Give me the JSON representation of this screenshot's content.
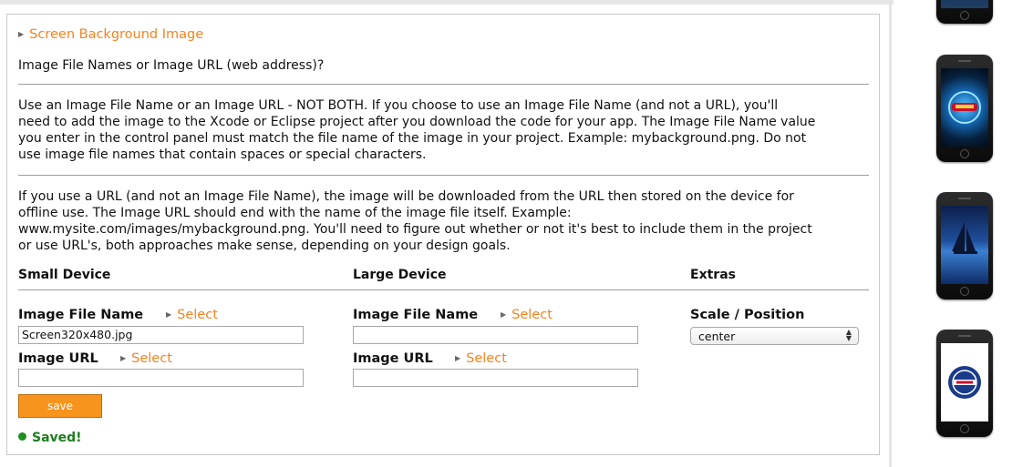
{
  "section": {
    "title": "Screen Background Image"
  },
  "question": "Image File Names or Image URL (web address)?",
  "paragraphs": {
    "p1_l1": "Use an Image File Name or an Image URL - NOT BOTH. If you choose to use an Image File Name (and not a URL), you'll",
    "p1_l2": "need to add the image to the Xcode or Eclipse project after you download the code for your app. The Image File Name value",
    "p1_l3": "you enter in the control panel must match the file name of the image in your project. Example: mybackground.png. Do not",
    "p1_l4": "use image file names that contain spaces or special characters.",
    "p2_l1": "If you use a URL (and not an Image File Name), the image will be downloaded from the URL then stored on the device for",
    "p2_l2": "offline use. The Image URL should end with the name of the image file itself. Example:",
    "p2_l3": "www.mysite.com/images/mybackground.png. You'll need to figure out whether or not it's best to include them in the project",
    "p2_l4": "or use URL's, both approaches make sense, depending on your design goals."
  },
  "columns": {
    "small": "Small Device",
    "large": "Large Device",
    "extras": "Extras"
  },
  "fields": {
    "image_file_name_label": "Image File Name",
    "image_url_label": "Image URL",
    "select_label": "Select",
    "small_file_value": "Screen320x480.jpg",
    "small_url_value": "",
    "large_file_value": "",
    "large_url_value": "",
    "scale_label": "Scale / Position",
    "scale_value": "center"
  },
  "actions": {
    "save_label": "save"
  },
  "status": {
    "saved_text": "Saved!",
    "color": "#1d7e1d"
  },
  "accent_color": "#f5821f",
  "thumbnails": [
    {
      "name": "phone-thumbnail-dark"
    },
    {
      "name": "phone-thumbnail-cars-logo"
    },
    {
      "name": "phone-thumbnail-sailboat"
    },
    {
      "name": "phone-thumbnail-badge"
    }
  ]
}
